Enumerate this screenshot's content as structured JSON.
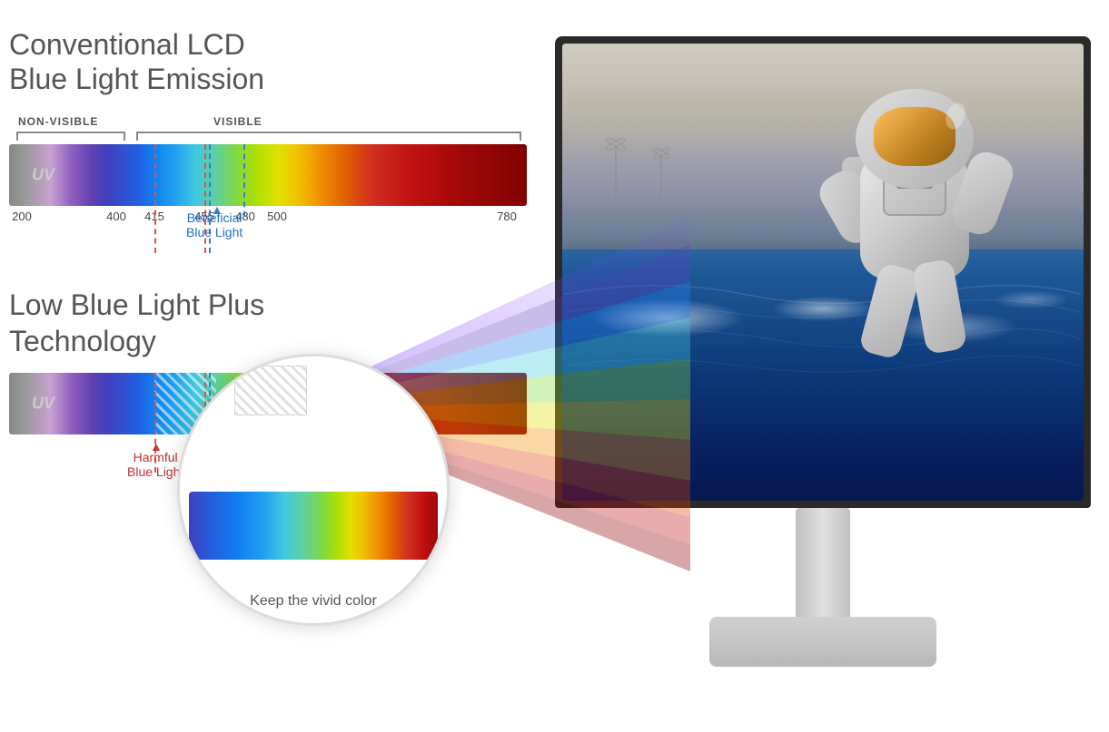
{
  "page": {
    "background": "#ffffff"
  },
  "left_panel": {
    "title_line1": "Conventional LCD",
    "title_line2": "Blue Light Emission",
    "label_nonvisible": "NON-VISIBLE",
    "label_visible": "VISIBLE",
    "uv_label": "UV",
    "scale_numbers": [
      "200",
      "400",
      "415",
      "455",
      "480",
      "500",
      "780"
    ],
    "beneficial_label_line1": "Beneficial",
    "beneficial_label_line2": "Blue Light",
    "second_title_line1": "Low Blue Light Plus",
    "second_title_line2": "Technology",
    "uv_label2": "UV",
    "harmful_label_line1": "Harmful",
    "harmful_label_line2": "Blue Light",
    "circle_text": "Keep the vivid color"
  },
  "monitor": {
    "alt_text": "Monitor displaying astronaut in space"
  }
}
